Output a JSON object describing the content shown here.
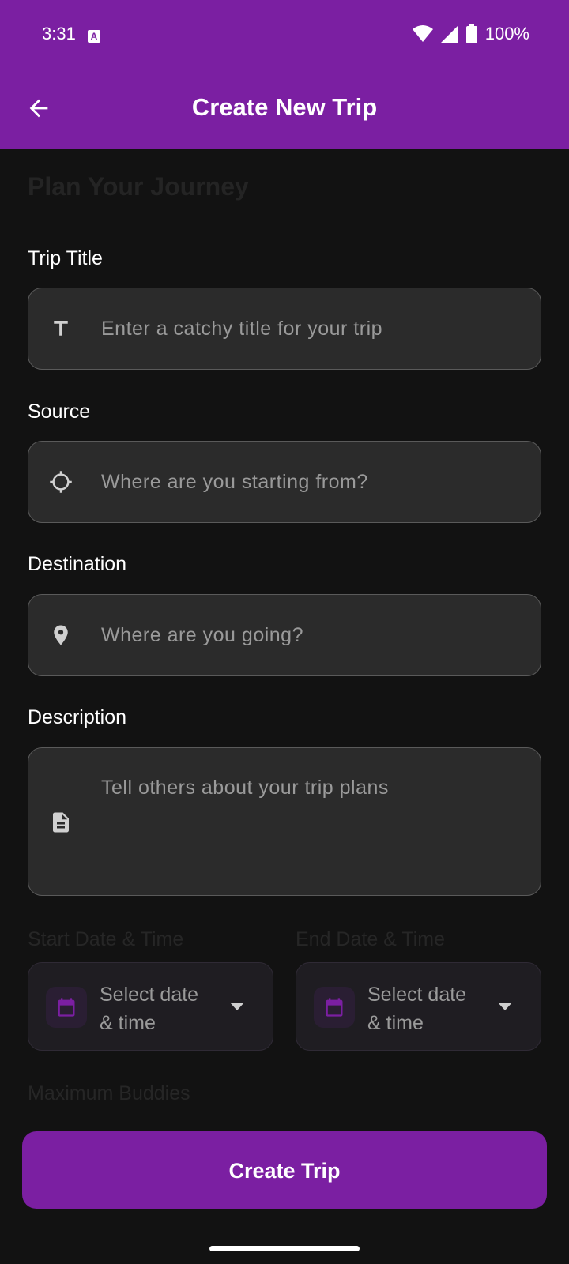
{
  "status_bar": {
    "time": "3:31",
    "notification_icon": "A",
    "battery": "100%"
  },
  "app_bar": {
    "title": "Create New Trip",
    "back_icon": "arrow-left"
  },
  "form": {
    "heading": "Plan Your Journey",
    "trip_title": {
      "label": "Trip Title",
      "placeholder": "Enter a catchy title for your trip",
      "icon": "title-icon"
    },
    "source": {
      "label": "Source",
      "placeholder": "Where are you starting from?",
      "icon": "crosshair-icon"
    },
    "destination": {
      "label": "Destination",
      "placeholder": "Where are you going?",
      "icon": "location-pin-icon"
    },
    "description": {
      "label": "Description",
      "placeholder": "Tell others about your trip plans",
      "icon": "document-icon"
    },
    "start_date": {
      "label": "Start Date & Time",
      "line1": "Select date",
      "line2": "& time"
    },
    "end_date": {
      "label": "End Date & Time",
      "line1": "Select date",
      "line2": "& time"
    },
    "max_buddies": {
      "label": "Maximum Buddies"
    }
  },
  "actions": {
    "create_label": "Create Trip"
  },
  "colors": {
    "primary": "#7b1fa2",
    "background": "#121212",
    "field": "#2b2b2b"
  }
}
